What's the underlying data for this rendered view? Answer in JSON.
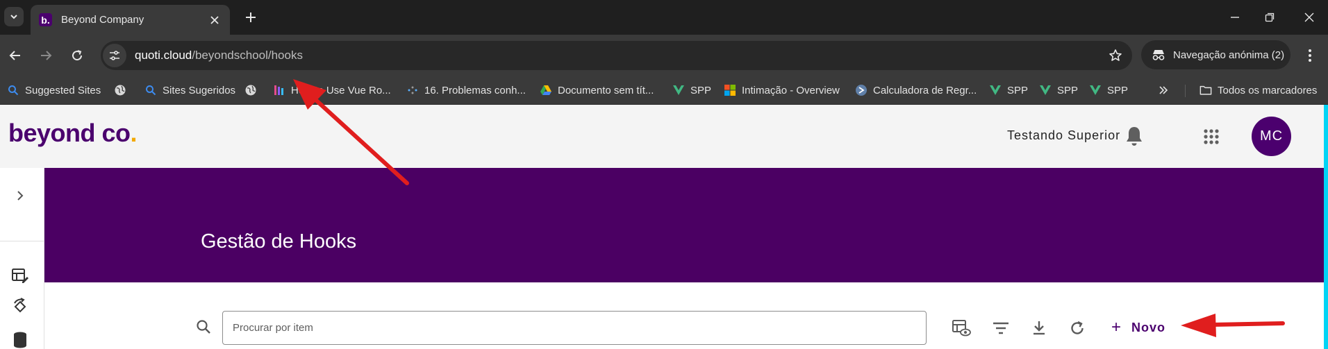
{
  "browser": {
    "tab": {
      "title": "Beyond Company",
      "favicon_letter": "b."
    },
    "omnibox": {
      "host": "quoti.cloud",
      "path": "/beyondschool/hooks"
    },
    "incognito_label": "Navegação anónima (2)",
    "bookmarks": [
      {
        "label": "Suggested Sites",
        "icon": "search-icon"
      },
      {
        "label": "",
        "icon": "globe-icon"
      },
      {
        "label": "Sites Sugeridos",
        "icon": "search-icon"
      },
      {
        "label": "",
        "icon": "globe-icon"
      },
      {
        "label": "How to Use Vue Ro...",
        "icon": "vue-icon"
      },
      {
        "label": "16. Problemas conh...",
        "icon": "dots-icon"
      },
      {
        "label": "Documento sem tít...",
        "icon": "drive-icon"
      },
      {
        "label": "SPP",
        "icon": "vue-icon"
      },
      {
        "label": "Intimação - Overview",
        "icon": "microsoft-icon"
      },
      {
        "label": "Calculadora de Regr...",
        "icon": "calculator-icon"
      },
      {
        "label": "SPP",
        "icon": "vue-icon"
      },
      {
        "label": "SPP",
        "icon": "vue-icon"
      },
      {
        "label": "SPP",
        "icon": "vue-icon"
      }
    ],
    "all_bookmarks_label": "Todos os marcadores"
  },
  "app": {
    "logo_text": "beyond co",
    "logo_dot": ".",
    "user_name": "Testando Superior",
    "avatar_initials": "MC"
  },
  "page": {
    "title": "Gestão de Hooks",
    "search_placeholder": "Procurar por item",
    "new_button_label": "Novo",
    "new_button_icon": "+"
  },
  "colors": {
    "brand_purple": "#4b006e",
    "banner_purple": "#4b0063",
    "logo_dot": "#f2a900",
    "annotation_red": "#e01e1e",
    "accent_cyan": "#00d4f5"
  }
}
